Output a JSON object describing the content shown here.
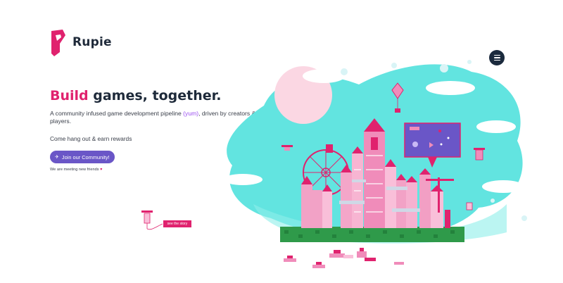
{
  "brand": {
    "name": "Rupie",
    "color": "#e0226e"
  },
  "hero": {
    "title_accent": "Build",
    "title_rest": " games, together.",
    "desc_before": "A community infused game development pipeline ",
    "desc_highlight": "(yum)",
    "desc_after": ", driven by creators & players.",
    "hangout": "Come hang out & earn rewards",
    "join_label": "Join our Community!",
    "meet_text": "We are meeting new friends"
  },
  "scene": {
    "story_label": "see the story"
  },
  "colors": {
    "accent": "#e0226e",
    "button": "#6a56c7",
    "teal": "#5fe3e0",
    "dark": "#1b2a3d"
  }
}
